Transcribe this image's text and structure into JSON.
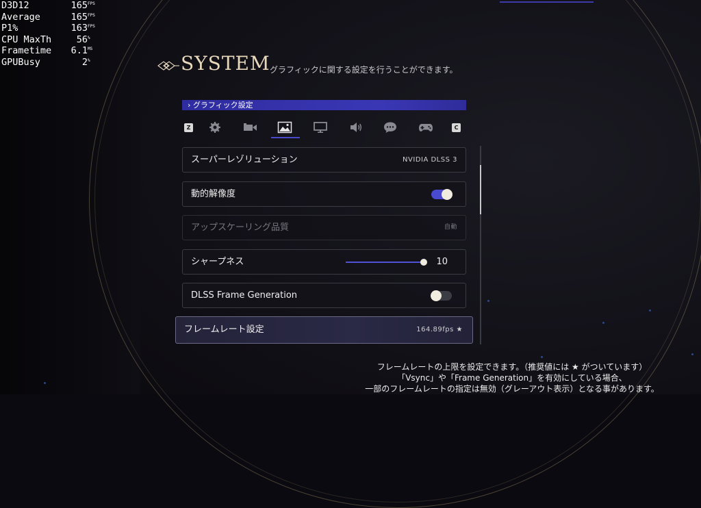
{
  "perf_overlay": [
    {
      "label": "D3D12",
      "value": "165",
      "unit": "FPS"
    },
    {
      "label": "Average",
      "value": "165",
      "unit": "FPS"
    },
    {
      "label": "P1%",
      "value": "163",
      "unit": "FPS"
    },
    {
      "label": "CPU MaxTh",
      "value": "56",
      "unit": "%"
    },
    {
      "label": "Frametime",
      "value": "6.1",
      "unit": "MS"
    },
    {
      "label": "GPUBusy",
      "value": "2",
      "unit": "%"
    }
  ],
  "header": {
    "title": "SYSTEM",
    "subtitle": "グラフィックに関する設定を行うことができます。"
  },
  "section": {
    "label": "› グラフィック設定"
  },
  "tabs": {
    "prev_key": "Z",
    "next_key": "C",
    "items": [
      {
        "icon": "gear-icon",
        "active": false
      },
      {
        "icon": "camera-icon",
        "active": false
      },
      {
        "icon": "image-icon",
        "active": true
      },
      {
        "icon": "monitor-icon",
        "active": false
      },
      {
        "icon": "speaker-icon",
        "active": false
      },
      {
        "icon": "chat-icon",
        "active": false
      },
      {
        "icon": "gamepad-icon",
        "active": false
      }
    ]
  },
  "settings": {
    "super_resolution": {
      "label": "スーパーレゾリューション",
      "value": "NVIDIA DLSS 3"
    },
    "dynamic_resolution": {
      "label": "動的解像度",
      "on": true
    },
    "upscaling_quality": {
      "label": "アップスケーリング品質",
      "value": "自動",
      "disabled": true
    },
    "sharpness": {
      "label": "シャープネス",
      "value": "10",
      "fraction": 1.0
    },
    "frame_generation": {
      "label": "DLSS Frame Generation",
      "on": false
    },
    "frame_rate": {
      "label": "フレームレート設定",
      "value": "164.89fps ★"
    }
  },
  "help_text": {
    "line1": "フレームレートの上限を設定できます。（推奨値には ★ がついています）",
    "line2": "「Vsync」や「Frame Generation」を有効にしている場合、",
    "line3": "一部のフレームレートの指定は無効（グレーアウト表示）となる事があります。"
  },
  "colors": {
    "accent": "#3a37b5",
    "title": "#e8d9bd",
    "toggle_on": "#4a4ad0"
  }
}
